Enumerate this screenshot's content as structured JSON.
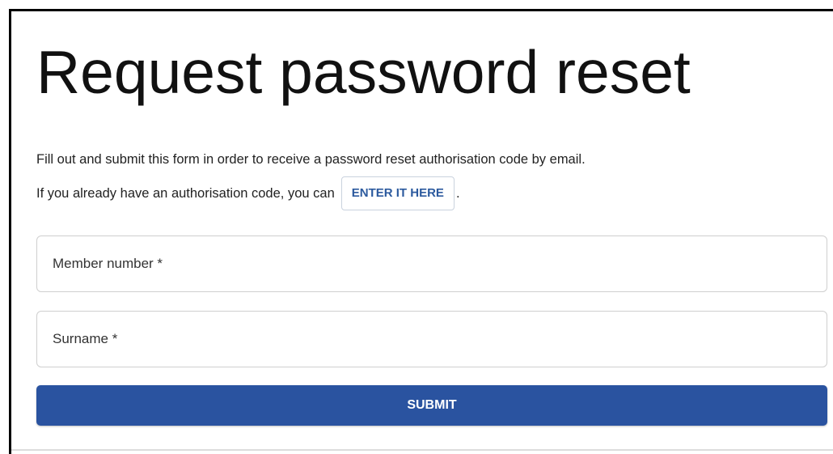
{
  "page": {
    "title": "Request password reset"
  },
  "intro": {
    "line1": "Fill out and submit this form in order to receive a password reset authorisation code by email.",
    "line2_prefix": "If you already have an authorisation code, you can",
    "enter_button": "ENTER IT HERE",
    "line2_suffix": "."
  },
  "form": {
    "member_number_label": "Member number *",
    "surname_label": "Surname *",
    "submit_label": "SUBMIT"
  },
  "colors": {
    "accent": "#2a53a0",
    "link_text": "#2c5a9e"
  }
}
